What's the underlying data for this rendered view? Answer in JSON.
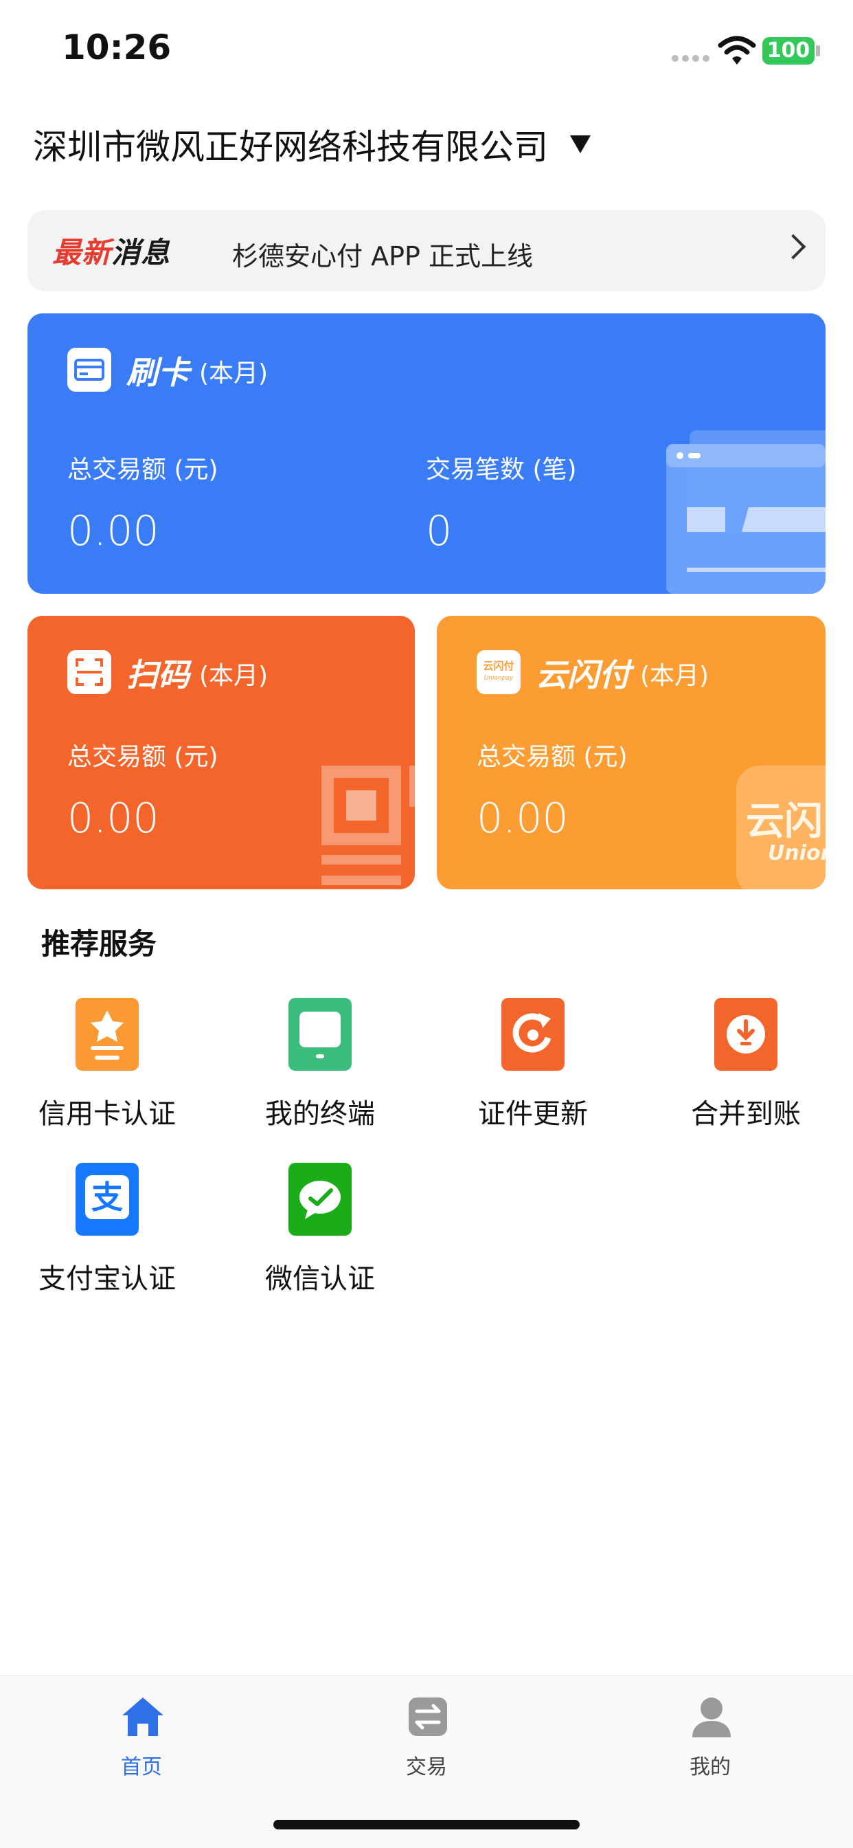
{
  "status_bar": {
    "time": "10:26",
    "battery": "100",
    "battery_color": "#34c759"
  },
  "header": {
    "company": "深圳市微风正好网络科技有限公司",
    "dropdown_icon": "caret-down-icon"
  },
  "news": {
    "tag_red": "最新",
    "tag_black": "消息",
    "text": "杉德安心付 APP 正式上线",
    "chevron": "chevron-right-icon"
  },
  "cards": {
    "swipe": {
      "title": "刷卡",
      "subtitle": "(本月)",
      "total_label": "总交易额 (元)",
      "total_value": "0.00",
      "count_label": "交易笔数 (笔)",
      "count_value": "0",
      "color": "#3a7cf6",
      "icon": "card-icon"
    },
    "scan": {
      "title": "扫码",
      "subtitle": "(本月)",
      "total_label": "总交易额 (元)",
      "total_value": "0.00",
      "color": "#f4652b",
      "icon": "scan-icon"
    },
    "unionpay": {
      "title": "云闪付",
      "subtitle": "(本月)",
      "total_label": "总交易额 (元)",
      "total_value": "0.00",
      "icon_text": "云闪付",
      "icon_sub": "Unionpay",
      "watermark_text": "云闪",
      "watermark_sub": "Unionp",
      "color": "#fc9d33"
    }
  },
  "services": {
    "title": "推荐服务",
    "items": [
      {
        "label": "信用卡认证",
        "icon": "credit-card-verify-icon",
        "color": "#fb9a33"
      },
      {
        "label": "我的终端",
        "icon": "terminal-icon",
        "color": "#3bbb7c"
      },
      {
        "label": "证件更新",
        "icon": "refresh-document-icon",
        "color": "#f4652b"
      },
      {
        "label": "合并到账",
        "icon": "download-merge-icon",
        "color": "#f4652b"
      },
      {
        "label": "支付宝认证",
        "icon": "alipay-icon",
        "color": "#1677ff",
        "glyph": "支"
      },
      {
        "label": "微信认证",
        "icon": "wechat-icon",
        "color": "#1aad19"
      }
    ]
  },
  "tabbar": {
    "items": [
      {
        "label": "首页",
        "icon": "home-icon",
        "active": true
      },
      {
        "label": "交易",
        "icon": "exchange-icon",
        "active": false
      },
      {
        "label": "我的",
        "icon": "user-icon",
        "active": false
      }
    ],
    "active_color": "#2f6fe8"
  }
}
